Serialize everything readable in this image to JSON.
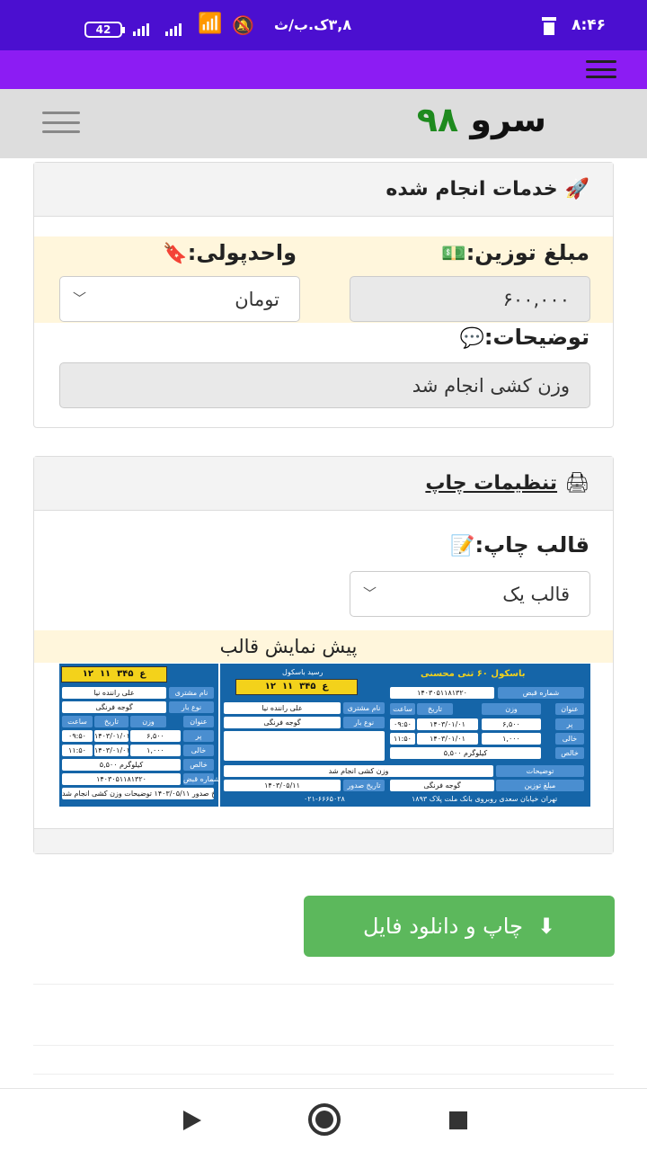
{
  "status_bar": {
    "time": "۸:۴۶",
    "carrier": "۳,۸ک.ب/ث",
    "battery": "42"
  },
  "brand": {
    "name": "سرو",
    "number": "۹۸"
  },
  "services_card": {
    "title": "خدمات انجام شده",
    "weigh_amount_label": "مبلغ توزین:",
    "weigh_amount_value": "۶۰۰,۰۰۰",
    "currency_label": "واحدپولی:",
    "currency_value": "تومان",
    "description_label": "توضیحات:",
    "description_value": "وزن کشی انجام شد"
  },
  "print_card": {
    "title": "تنظیمات چاپ",
    "template_label": "قالب چاپ:",
    "template_value": "قالب یک",
    "preview_label": "پیش نمایش قالب"
  },
  "template_preview": {
    "company": "باسکول ۶۰ تنی محسنی",
    "receipt": "رسید باسکول",
    "serial": "۱۴۰۳۰۵۱۱۸۱۳۲۰",
    "serial_label": "شماره قبض",
    "customer_label": "نام مشتری",
    "driver": "علی راننده نیا",
    "cargo_label": "نوع بار",
    "cargo": "گوجه فرنگی",
    "col_title": "عنوان",
    "col_weight": "وزن",
    "col_date": "تاریخ",
    "col_time": "ساعت",
    "full_label": "پر",
    "full_weight": "۶,۵۰۰",
    "empty_label": "خالی",
    "empty_weight": "۱,۰۰۰",
    "date": "۱۴۰۳/۰۱/۰۱",
    "time_full": "۰۹:۵۰",
    "time_empty": "۱۱:۵۰",
    "net_label": "خالص",
    "net": "۵,۵۰۰ کیلوگرم",
    "notes_label": "توضیحات",
    "notes": "وزن کشی انجام شد",
    "amount_label": "مبلغ توزین",
    "issue_label": "تاریخ صدور",
    "issue_date": "۱۴۰۳/۰۵/۱۱",
    "plate_left": "۱۲",
    "plate_letter": "ع",
    "plate_mid": "۳۴۵",
    "plate_right": "۱۱",
    "address": "تهران خیابان سعدی روبروی بانک ملت پلاک ۱۸۹۳",
    "phone": "۰۲۱-۶۶۶۵۰۲۸",
    "issue_footer": "تاریخ صدور ۱۴۰۳/۰۵/۱۱ توضیحات وزن کشی انجام شد"
  },
  "print_button": {
    "label": "چاپ و دانلود فایل"
  }
}
